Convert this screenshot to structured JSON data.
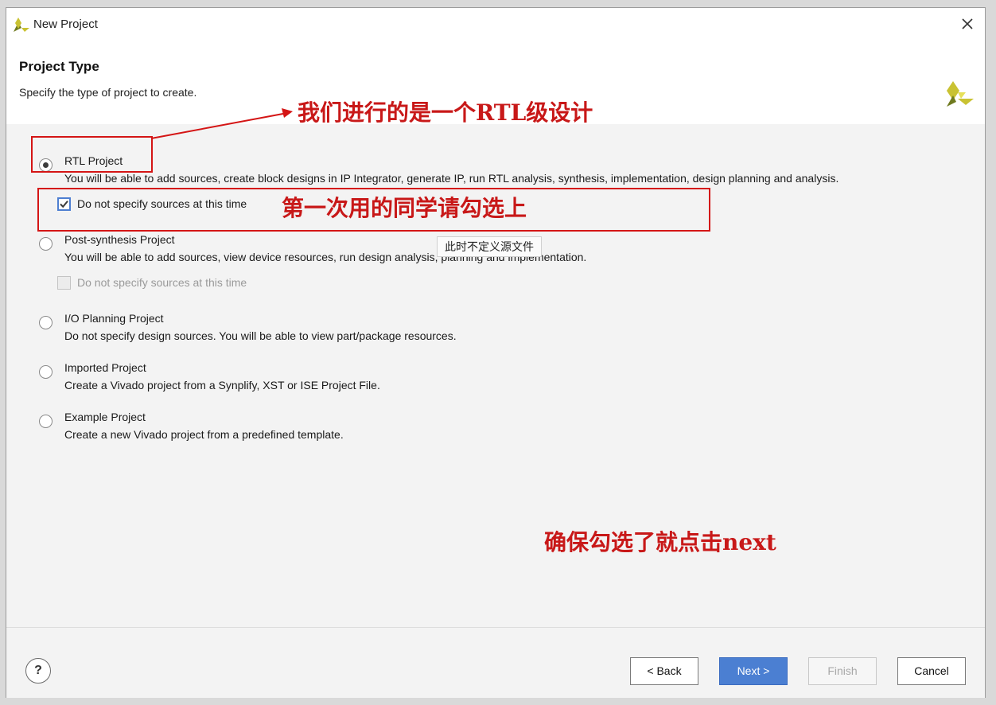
{
  "window": {
    "title": "New Project"
  },
  "header": {
    "title": "Project Type",
    "subtitle": "Specify the type of project to create."
  },
  "options": [
    {
      "label": "RTL Project",
      "description": "You will be able to add sources, create block designs in IP Integrator, generate IP, run RTL analysis, synthesis, implementation, design planning and analysis.",
      "selected": true
    },
    {
      "label": "Post-synthesis Project",
      "description": "You will be able to add sources, view device resources, run design analysis, planning and implementation.",
      "selected": false
    },
    {
      "label": "I/O Planning Project",
      "description": "Do not specify design sources. You will be able to view part/package resources.",
      "selected": false
    },
    {
      "label": "Imported Project",
      "description": "Create a Vivado project from a Synplify, XST or ISE Project File.",
      "selected": false
    },
    {
      "label": "Example Project",
      "description": "Create a new Vivado project from a predefined template.",
      "selected": false
    }
  ],
  "checkboxes": {
    "rtl_no_sources": {
      "label": "Do not specify sources at this time",
      "checked": true
    },
    "postsynth_no_sources": {
      "label": "Do not specify sources at this time",
      "checked": false,
      "disabled": true
    }
  },
  "tooltip": "此时不定义源文件",
  "annotations": {
    "rtl": "我们进行的是一个RTL级设计",
    "check": "第一次用的同学请勾选上",
    "next": "确保勾选了就点击next"
  },
  "footer": {
    "help": "?",
    "back": "< Back",
    "next": "Next >",
    "finish": "Finish",
    "cancel": "Cancel"
  },
  "colors": {
    "accent": "#4b7fd2",
    "annotation": "#c81818",
    "logo_yellow": "#c9c232",
    "logo_olive": "#6f7a1f"
  }
}
